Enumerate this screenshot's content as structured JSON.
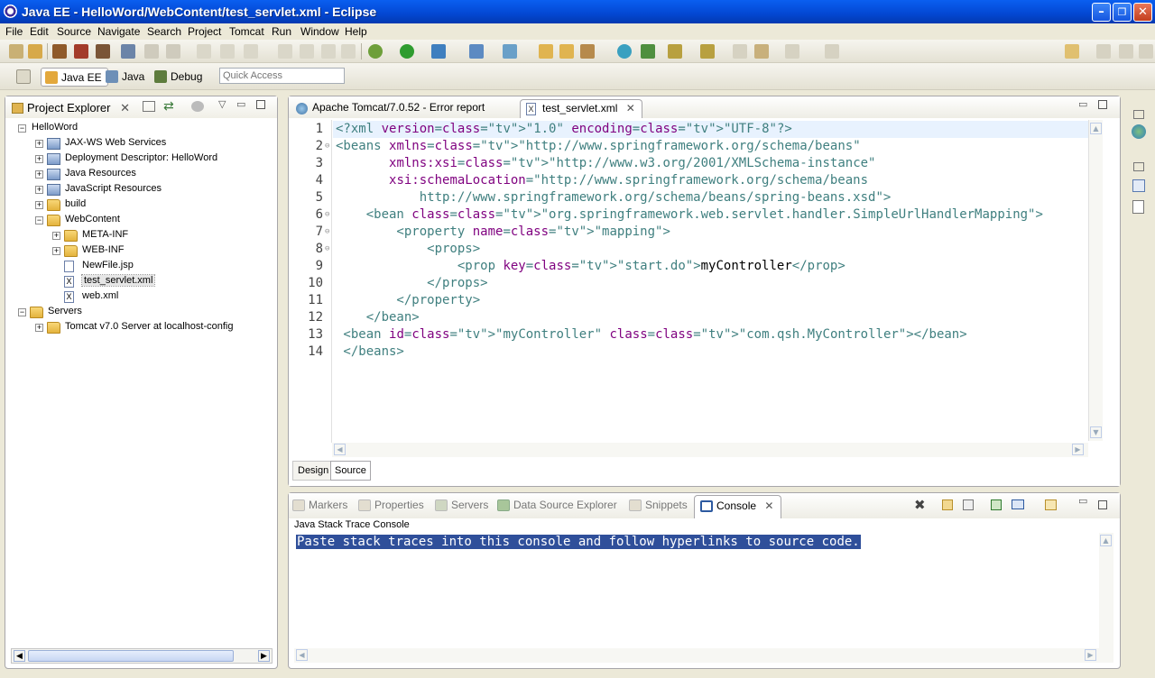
{
  "window": {
    "title": "Java EE - HelloWord/WebContent/test_servlet.xml - Eclipse"
  },
  "menu": [
    "File",
    "Edit",
    "Source",
    "Navigate",
    "Search",
    "Project",
    "Tomcat",
    "Run",
    "Window",
    "Help"
  ],
  "perspectives": [
    "Java EE",
    "Java",
    "Debug"
  ],
  "quick_access": {
    "placeholder": "Quick Access"
  },
  "project_explorer": {
    "title": "Project Explorer",
    "tree": [
      {
        "label": "HelloWord",
        "type": "project"
      },
      {
        "label": "JAX-WS Web Services",
        "type": "node"
      },
      {
        "label": "Deployment Descriptor: HelloWord",
        "type": "node"
      },
      {
        "label": "Java Resources",
        "type": "node"
      },
      {
        "label": "JavaScript Resources",
        "type": "node"
      },
      {
        "label": "build",
        "type": "folder"
      },
      {
        "label": "WebContent",
        "type": "folder"
      },
      {
        "label": "META-INF",
        "type": "folder"
      },
      {
        "label": "WEB-INF",
        "type": "folder"
      },
      {
        "label": "NewFile.jsp",
        "type": "file"
      },
      {
        "label": "test_servlet.xml",
        "type": "xml",
        "selected": true
      },
      {
        "label": "web.xml",
        "type": "xml"
      },
      {
        "label": "Servers",
        "type": "folder"
      },
      {
        "label": "Tomcat v7.0 Server at localhost-config",
        "type": "folder"
      }
    ]
  },
  "editor": {
    "tabs": [
      {
        "label": "Apache Tomcat/7.0.52 - Error report"
      },
      {
        "label": "test_servlet.xml",
        "active": true
      }
    ],
    "bottom_tabs": [
      "Design",
      "Source"
    ],
    "line_numbers": [
      "1",
      "2",
      "3",
      "4",
      "5",
      "6",
      "7",
      "8",
      "9",
      "10",
      "11",
      "12",
      "13",
      "14"
    ],
    "lines": [
      "<?xml version=\"1.0\" encoding=\"UTF-8\"?>",
      "<beans xmlns=\"http://www.springframework.org/schema/beans\"",
      "       xmlns:xsi=\"http://www.w3.org/2001/XMLSchema-instance\"",
      "       xsi:schemaLocation=\"http://www.springframework.org/schema/beans",
      "           http://www.springframework.org/schema/beans/spring-beans.xsd\">",
      "    <bean class=\"org.springframework.web.servlet.handler.SimpleUrlHandlerMapping\">",
      "        <property name=\"mapping\">",
      "            <props>",
      "                <prop key=\"start.do\">myController</prop>",
      "            </props>",
      "        </property>",
      "    </bean>",
      " <bean id=\"myController\" class=\"com.qsh.MyController\"></bean>",
      " </beans>"
    ]
  },
  "console": {
    "tabs": [
      "Markers",
      "Properties",
      "Servers",
      "Data Source Explorer",
      "Snippets",
      "Console"
    ],
    "active_tab": "Console",
    "subtitle": "Java Stack Trace Console",
    "text": "Paste stack traces into this console and follow hyperlinks to source code."
  }
}
